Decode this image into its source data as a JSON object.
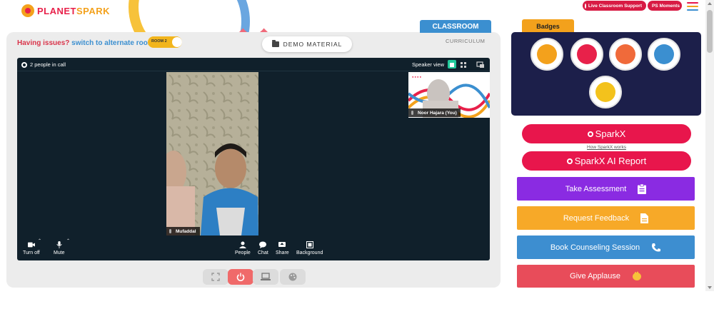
{
  "header": {
    "logo_text_1": "PLANET",
    "logo_text_2": "SPARK",
    "live_support": "Live Classroom Support",
    "ps_moments": "PS Moments"
  },
  "classroom": {
    "tab_label": "CLASSROOM",
    "curriculum_label": "CURRICULUM",
    "issues_question": "Having issues?",
    "issues_link": "switch to alternate room",
    "room_toggle": "ROOM 2",
    "demo_material": "DEMO MATERIAL"
  },
  "video": {
    "people_count": "2 people in call",
    "speaker_view": "Speaker view",
    "main_participant": "Mufaddal",
    "self_participant": "Noor Hajara (You)",
    "controls": {
      "camera": "Turn off",
      "mute": "Mute",
      "people": "People",
      "chat": "Chat",
      "share": "Share",
      "background": "Background"
    }
  },
  "badges": {
    "title": "Badges",
    "items": [
      "trophy-badge",
      "fist-badge",
      "meditation-badge",
      "lightbulb-badge",
      "brain-badge"
    ]
  },
  "sidebar": {
    "sparkx": "SparkX",
    "how_sparkx": "How SparkX works",
    "sparkx_report": "SparkX AI Report",
    "take_assessment": "Take Assessment",
    "request_feedback": "Request Feedback",
    "book_counseling": "Book Counseling Session",
    "give_applause": "Give Applause"
  },
  "colors": {
    "brand_red": "#e8164c",
    "brand_orange": "#f3a11c",
    "classroom_blue": "#3b8fd0",
    "badges_navy": "#1c1f4a",
    "assessment_purple": "#8a2be2",
    "feedback_orange": "#f7a928",
    "counseling_blue": "#3d8ed0",
    "applause_red": "#e84c5a"
  }
}
